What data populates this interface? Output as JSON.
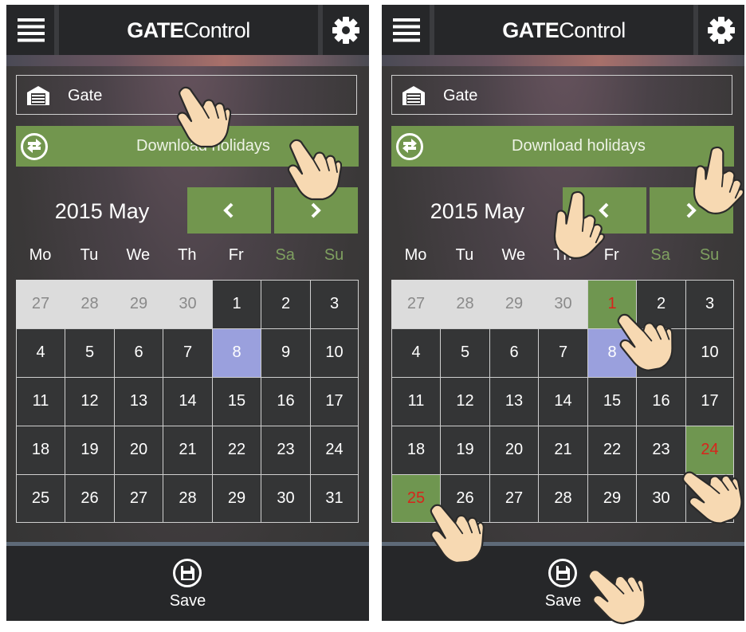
{
  "screens": [
    {
      "title_bold": "GATE",
      "title_rest": "Control",
      "gate_label": "Gate",
      "download_label": "Download holidays",
      "month_label": "2015 May",
      "weekdays": [
        "Mo",
        "Tu",
        "We",
        "Th",
        "Fr",
        "Sa",
        "Su"
      ],
      "days": [
        "27",
        "28",
        "29",
        "30",
        "1",
        "2",
        "3",
        "4",
        "5",
        "6",
        "7",
        "8",
        "9",
        "10",
        "11",
        "12",
        "13",
        "14",
        "15",
        "16",
        "17",
        "18",
        "19",
        "20",
        "21",
        "22",
        "23",
        "24",
        "25",
        "26",
        "27",
        "28",
        "29",
        "30",
        "31"
      ],
      "prev_month_cells": 4,
      "today_index": 11,
      "holiday_indices": [],
      "save_label": "Save",
      "hand_pointers": 2
    },
    {
      "title_bold": "GATE",
      "title_rest": "Control",
      "gate_label": "Gate",
      "download_label": "Download holidays",
      "month_label": "2015 May",
      "weekdays": [
        "Mo",
        "Tu",
        "We",
        "Th",
        "Fr",
        "Sa",
        "Su"
      ],
      "days": [
        "27",
        "28",
        "29",
        "30",
        "1",
        "2",
        "3",
        "4",
        "5",
        "6",
        "7",
        "8",
        "9",
        "10",
        "11",
        "12",
        "13",
        "14",
        "15",
        "16",
        "17",
        "18",
        "19",
        "20",
        "21",
        "22",
        "23",
        "24",
        "25",
        "26",
        "27",
        "28",
        "29",
        "30",
        "31"
      ],
      "prev_month_cells": 4,
      "today_index": 11,
      "holiday_indices": [
        4,
        27,
        28
      ],
      "save_label": "Save",
      "hand_pointers": 6
    }
  ],
  "colors": {
    "accent_green": "#72964e",
    "weekend_text": "#7fa060",
    "today_fill": "#9aa0dd",
    "holiday_text": "#d8241b",
    "header_bg": "#262729"
  },
  "icons": {
    "menu": "hamburger-icon",
    "settings": "gear-icon",
    "gate": "garage-icon",
    "download": "sync-arrows-icon",
    "prev": "chevron-left-icon",
    "next": "chevron-right-icon",
    "save": "floppy-disk-icon",
    "tutorial": "hand-pointer-icon"
  }
}
